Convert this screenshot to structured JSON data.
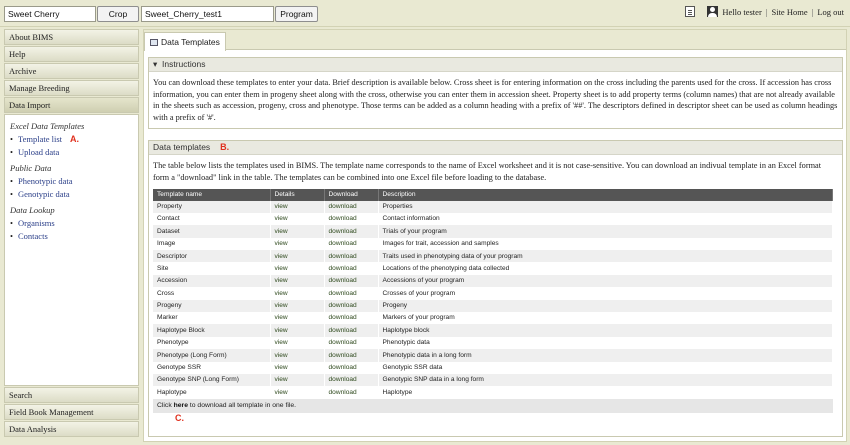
{
  "topbar": {
    "species": "Sweet Cherry",
    "crop_button": "Crop",
    "program_value": "Sweet_Cherry_test1",
    "program_button": "Program",
    "greeting": "Hello tester",
    "site_home": "Site Home",
    "logout": "Log out"
  },
  "sidebar": {
    "top_items": [
      "About BIMS",
      "Help",
      "Archive",
      "Manage Breeding",
      "Data Import"
    ],
    "sections": [
      {
        "title": "Excel Data Templates",
        "links": [
          "Template list",
          "Upload data"
        ]
      },
      {
        "title": "Public Data",
        "links": [
          "Phenotypic data",
          "Genotypic data"
        ]
      },
      {
        "title": "Data Lookup",
        "links": [
          "Organisms",
          "Contacts"
        ]
      }
    ],
    "bottom_items": [
      "Search",
      "Field Book Management",
      "Data Analysis"
    ]
  },
  "annotations": {
    "a": "A.",
    "b": "B.",
    "c": "C."
  },
  "tab": {
    "label": "Data Templates"
  },
  "instructions": {
    "title": "Instructions",
    "text": "You can download these templates to enter your data. Brief description is available below. Cross sheet is for entering information on the cross including the parents used for the cross. If accession has cross information, you can enter them in progeny sheet along with the cross, otherwise you can enter them in accession sheet. Property sheet is to add property terms (column names) that are not already available in the sheets such as accession, progeny, cross and phenotype. Those terms can be added as a column heading with a prefix of '##'. The descriptors defined in descriptor sheet can be used as column headings with a prefix of '#'."
  },
  "templates": {
    "title": "Data templates",
    "text": "The table below lists the templates used in BIMS. The template name corresponds to the name of Excel worksheet and it is not case-sensitive. You can download an indivual template in an Excel format form a \"download\" link in the table. The templates can be combined into one Excel file before loading to the database.",
    "columns": [
      "Template name",
      "Details",
      "Download",
      "Description"
    ],
    "rows": [
      [
        "Property",
        "view",
        "download",
        "Properties"
      ],
      [
        "Contact",
        "view",
        "download",
        "Contact information"
      ],
      [
        "Dataset",
        "view",
        "download",
        "Trials of your program"
      ],
      [
        "Image",
        "view",
        "download",
        "Images for trait, accession and samples"
      ],
      [
        "Descriptor",
        "view",
        "download",
        "Traits used in phenotyping data of your program"
      ],
      [
        "Site",
        "view",
        "download",
        "Locations of the phenotyping data collected"
      ],
      [
        "Accession",
        "view",
        "download",
        "Accessions of your program"
      ],
      [
        "Cross",
        "view",
        "download",
        "Crosses of your program"
      ],
      [
        "Progeny",
        "view",
        "download",
        "Progeny"
      ],
      [
        "Marker",
        "view",
        "download",
        "Markers of your program"
      ],
      [
        "Haplotype Block",
        "view",
        "download",
        "Haplotype block"
      ],
      [
        "Phenotype",
        "view",
        "download",
        "Phenotypic data"
      ],
      [
        "Phenotype (Long Form)",
        "view",
        "download",
        "Phenotypic data in a long form"
      ],
      [
        "Genotype SSR",
        "view",
        "download",
        "Genotypic SSR data"
      ],
      [
        "Genotype SNP (Long Form)",
        "view",
        "download",
        "Genotypic SNP data in a long form"
      ],
      [
        "Haplotype",
        "view",
        "download",
        "Haplotype"
      ]
    ],
    "footer_pre": "Click ",
    "footer_link": "here",
    "footer_post": " to download all template in one file."
  }
}
